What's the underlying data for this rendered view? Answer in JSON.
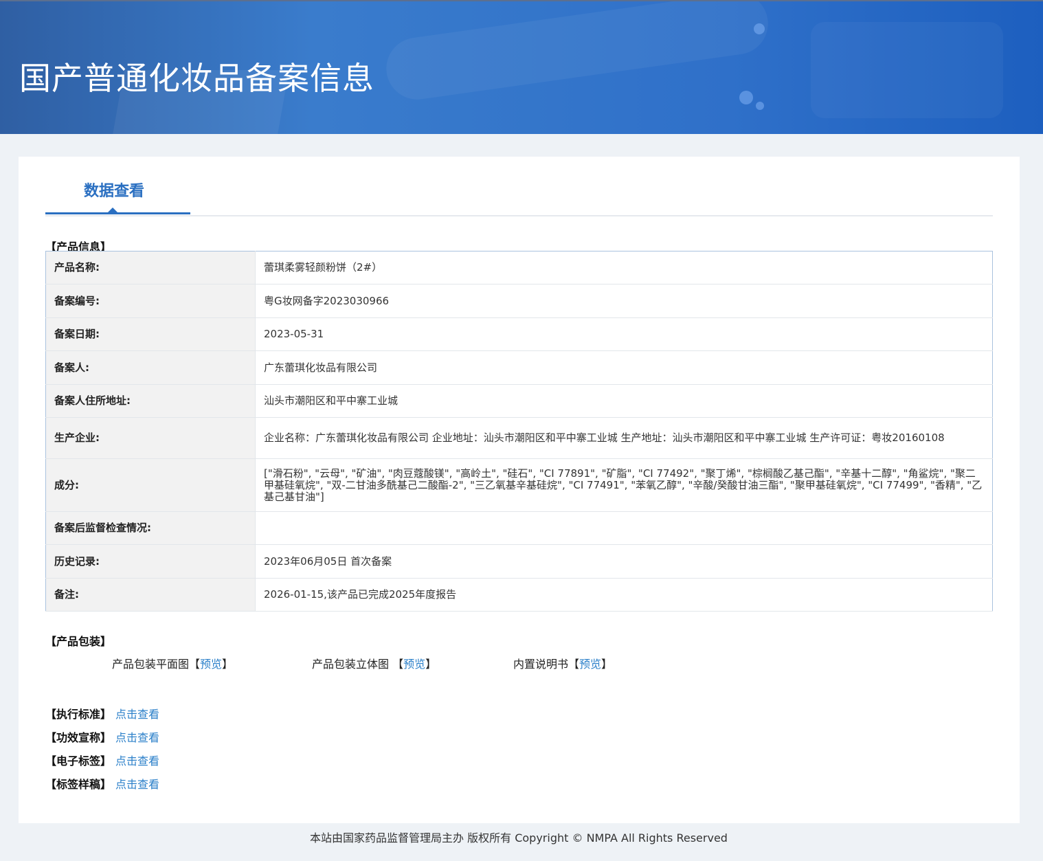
{
  "header": {
    "title": "国产普通化妆品备案信息"
  },
  "tabs": [
    {
      "label": "数据查看",
      "active": true
    }
  ],
  "product_info": {
    "section_title": "【产品信息】",
    "rows": [
      {
        "label": "产品名称:",
        "value": "蕾琪柔雾轻颜粉饼（2#）"
      },
      {
        "label": "备案编号:",
        "value": "粤G妆网备字2023030966"
      },
      {
        "label": "备案日期:",
        "value": "2023-05-31"
      },
      {
        "label": "备案人:",
        "value": "广东蕾琪化妆品有限公司"
      },
      {
        "label": "备案人住所地址:",
        "value": "汕头市潮阳区和平中寨工业城"
      },
      {
        "label": "生产企业:",
        "value": "企业名称：广东蕾琪化妆品有限公司 企业地址：汕头市潮阳区和平中寨工业城 生产地址：汕头市潮阳区和平中寨工业城 生产许可证：粤妆20160108"
      },
      {
        "label": "成分:",
        "value": "[\"滑石粉\", \"云母\", \"矿油\", \"肉豆蔻酸镁\", \"高岭土\", \"硅石\", \"CI 77891\", \"矿脂\", \"CI 77492\", \"聚丁烯\", \"棕榈酸乙基己酯\", \"辛基十二醇\", \"角鲨烷\", \"聚二甲基硅氧烷\", \"双-二甘油多酰基己二酸酯-2\", \"三乙氧基辛基硅烷\", \"CI 77491\", \"苯氧乙醇\", \"辛酸/癸酸甘油三酯\", \"聚甲基硅氧烷\", \"CI 77499\", \"香精\", \"乙基己基甘油\"]"
      },
      {
        "label": "备案后监督检查情况:",
        "value": ""
      },
      {
        "label": "历史记录:",
        "value": "2023年06月05日 首次备案"
      },
      {
        "label": "备注:",
        "value": "2026-01-15,该产品已完成2025年度报告"
      }
    ]
  },
  "packaging": {
    "section_title": "【产品包装】",
    "items": [
      {
        "label": "产品包装平面图",
        "open": "【",
        "link": "预览",
        "close": "】"
      },
      {
        "label": "产品包装立体图 ",
        "open": "【",
        "link": "预览",
        "close": "】"
      },
      {
        "label": "内置说明书",
        "open": "【",
        "link": "预览",
        "close": "】"
      }
    ]
  },
  "extras": [
    {
      "label": "【执行标准】",
      "link": "点击查看"
    },
    {
      "label": "【功效宣称】",
      "link": "点击查看"
    },
    {
      "label": "【电子标签】",
      "link": "点击查看"
    },
    {
      "label": "【标签样稿】",
      "link": "点击查看"
    }
  ],
  "footer": {
    "text": "本站由国家药品监督管理局主办 版权所有 Copyright © NMPA All Rights Reserved"
  }
}
